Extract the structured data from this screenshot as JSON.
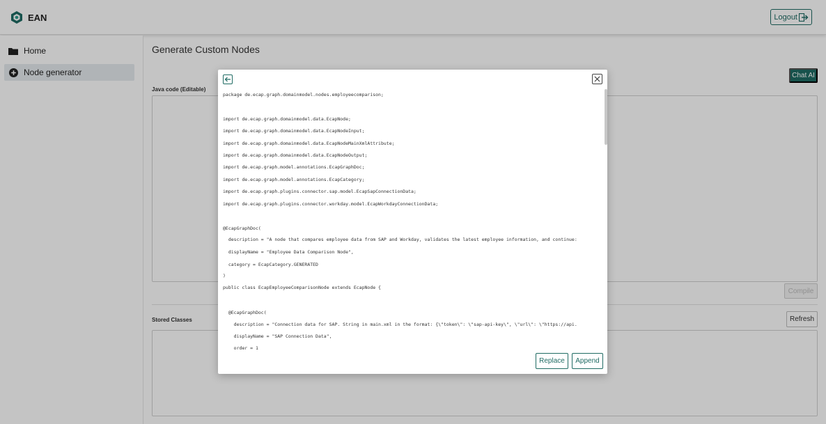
{
  "header": {
    "brand_name": "EAN",
    "logout_label": "Logout"
  },
  "sidebar": {
    "items": [
      {
        "label": "Home",
        "icon": "folder-icon"
      },
      {
        "label": "Node generator",
        "icon": "plus-circle-icon",
        "active": true
      }
    ]
  },
  "main": {
    "title": "Generate Custom Nodes",
    "chat_ai_label": "Chat AI",
    "java_code_label": "Java code (Editable)",
    "compile_label": "Compile",
    "stored_classes_label": "Stored Classes",
    "refresh_label": "Refresh"
  },
  "modal": {
    "code_lines": [
      "package de.ecap.graph.domainmodel.nodes.employeecomparison;",
      "",
      "import de.ecap.graph.domainmodel.data.EcapNode;",
      "import de.ecap.graph.domainmodel.data.EcapNodeInput;",
      "import de.ecap.graph.domainmodel.data.EcapNodeMainXmlAttribute;",
      "import de.ecap.graph.domainmodel.data.EcapNodeOutput;",
      "import de.ecap.graph.model.annotations.EcapGraphDoc;",
      "import de.ecap.graph.model.annotations.EcapCategory;",
      "import de.ecap.graph.plugins.connector.sap.model.EcapSapConnectionData;",
      "import de.ecap.graph.plugins.connector.workday.model.EcapWorkdayConnectionData;",
      "",
      "@EcapGraphDoc(",
      "  description = \"A node that compares employee data from SAP and Workday, validates the latest employee information, and continue:",
      "  displayName = \"Employee Data Comparison Node\",",
      "  category = EcapCategory.GENERATED",
      ")",
      "public class EcapEmployeeComparisonNode extends EcapNode {",
      "",
      "  @EcapGraphDoc(",
      "    description = \"Connection data for SAP. String in main.xml in the format: {\\\"token\\\": \\\"sap-api-key\\\", \\\"url\\\": \\\"https://api.",
      "    displayName = \"SAP Connection Data\",",
      "    order = 1"
    ],
    "replace_label": "Replace",
    "append_label": "Append"
  },
  "colors": {
    "accent": "#1f6b63",
    "overlay": "rgba(0,0,0,0.23)"
  }
}
